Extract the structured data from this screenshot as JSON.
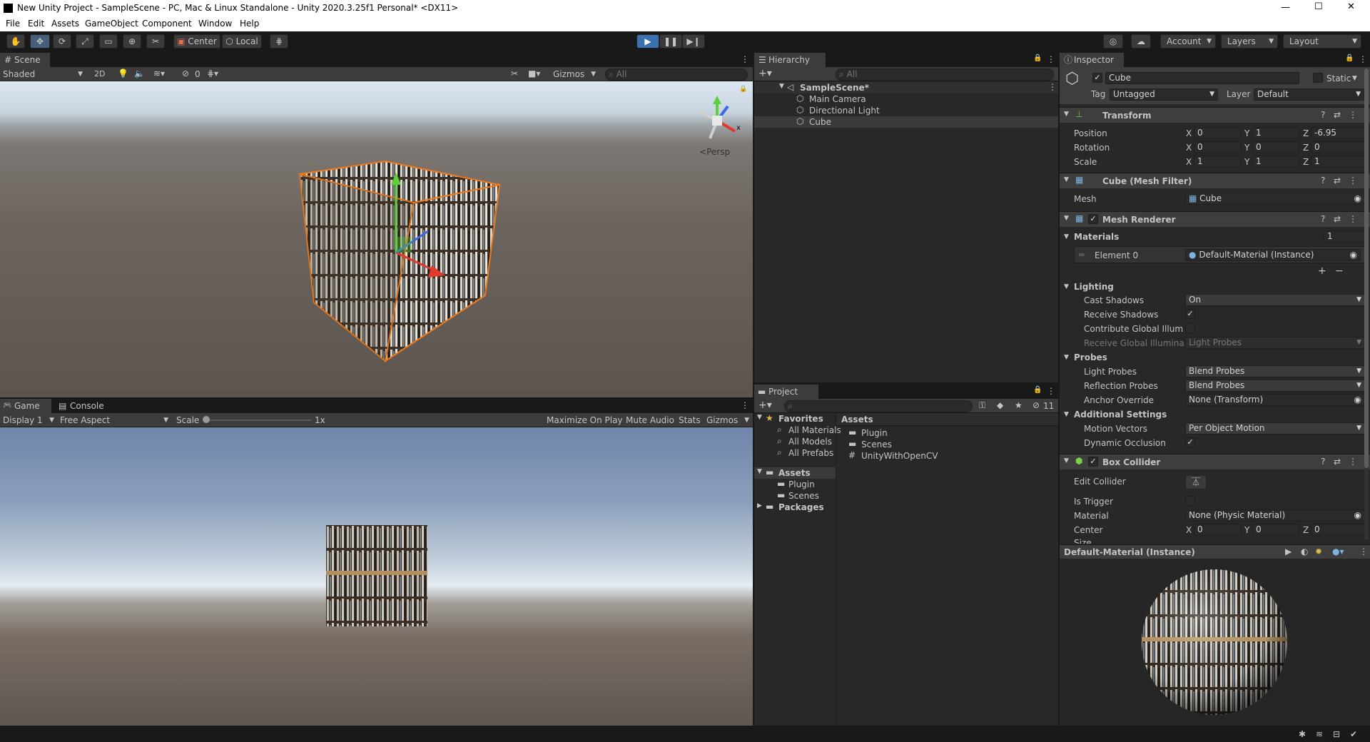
{
  "window": {
    "title": "New Unity Project - SampleScene - PC, Mac & Linux Standalone - Unity 2020.3.25f1 Personal* <DX11>",
    "controls": [
      "—",
      "☐",
      "✕"
    ]
  },
  "menu": [
    "File",
    "Edit",
    "Assets",
    "GameObject",
    "Component",
    "Window",
    "Help"
  ],
  "toolbar": {
    "pivot": "Center",
    "space": "Local",
    "account": "Account",
    "layers": "Layers",
    "layout": "Layout"
  },
  "scene": {
    "tab": "Scene",
    "shading": "Shaded",
    "mode2d": "2D",
    "hidden_count": "0",
    "gizmos": "Gizmos",
    "search_placeholder": "All",
    "persp": "Persp",
    "axis_x": "x"
  },
  "game": {
    "tab": "Game",
    "console_tab": "Console",
    "display": "Display 1",
    "aspect": "Free Aspect",
    "scale_label": "Scale",
    "scale_value": "1x",
    "maximize": "Maximize On Play",
    "mute": "Mute Audio",
    "stats": "Stats",
    "gizmos": "Gizmos",
    "scale_fraction": 0.0
  },
  "hierarchy": {
    "tab": "Hierarchy",
    "search_placeholder": "All",
    "scene_name": "SampleScene*",
    "items": [
      "Main Camera",
      "Directional Light",
      "Cube"
    ]
  },
  "project": {
    "tab": "Project",
    "hidden_count": "11",
    "favorites_label": "Favorites",
    "favorites": [
      "All Materials",
      "All Models",
      "All Prefabs"
    ],
    "assets_label": "Assets",
    "asset_folders": [
      "Plugin",
      "Scenes"
    ],
    "packages_label": "Packages",
    "breadcrumb": "Assets",
    "files": [
      {
        "name": "Plugin",
        "icon": "folder-icon"
      },
      {
        "name": "Scenes",
        "icon": "folder-icon"
      },
      {
        "name": "UnityWithOpenCV",
        "icon": "script-icon"
      }
    ]
  },
  "inspector": {
    "tab": "Inspector",
    "object_name": "Cube",
    "static_label": "Static",
    "tag_label": "Tag",
    "tag_value": "Untagged",
    "layer_label": "Layer",
    "layer_value": "Default",
    "transform": {
      "title": "Transform",
      "position_label": "Position",
      "rotation_label": "Rotation",
      "scale_label": "Scale",
      "position": [
        "0",
        "1",
        "-6.95"
      ],
      "rotation": [
        "0",
        "0",
        "0"
      ],
      "scale": [
        "1",
        "1",
        "1"
      ],
      "axes": [
        "X",
        "Y",
        "Z"
      ]
    },
    "mesh_filter": {
      "title": "Cube (Mesh Filter)",
      "mesh_label": "Mesh",
      "mesh_value": "Cube"
    },
    "mesh_renderer": {
      "title": "Mesh Renderer",
      "materials_label": "Materials",
      "materials_count": "1",
      "element0_label": "Element 0",
      "element0_value": "Default-Material (Instance)",
      "lighting_label": "Lighting",
      "cast_shadows_label": "Cast Shadows",
      "cast_shadows_value": "On",
      "receive_shadows_label": "Receive Shadows",
      "contribute_gi_label": "Contribute Global Illumina",
      "receive_gi_label": "Receive Global Illuminati",
      "receive_gi_value": "Light Probes",
      "probes_label": "Probes",
      "light_probes_label": "Light Probes",
      "light_probes_value": "Blend Probes",
      "reflection_probes_label": "Reflection Probes",
      "reflection_probes_value": "Blend Probes",
      "anchor_override_label": "Anchor Override",
      "anchor_override_value": "None (Transform)",
      "additional_label": "Additional Settings",
      "motion_vectors_label": "Motion Vectors",
      "motion_vectors_value": "Per Object Motion",
      "dynamic_occlusion_label": "Dynamic Occlusion"
    },
    "box_collider": {
      "title": "Box Collider",
      "edit_collider_label": "Edit Collider",
      "is_trigger_label": "Is Trigger",
      "material_label": "Material",
      "material_value": "None (Physic Material)",
      "center_label": "Center",
      "center": [
        "0",
        "0",
        "0"
      ],
      "size_label": "Size"
    },
    "preview": {
      "title": "Default-Material (Instance)"
    }
  },
  "colors": {
    "accent_blue": "#3a72b0",
    "selection_orange": "#f07a1a",
    "panel_bg": "#282828",
    "header_bg": "#3e3e3e"
  }
}
